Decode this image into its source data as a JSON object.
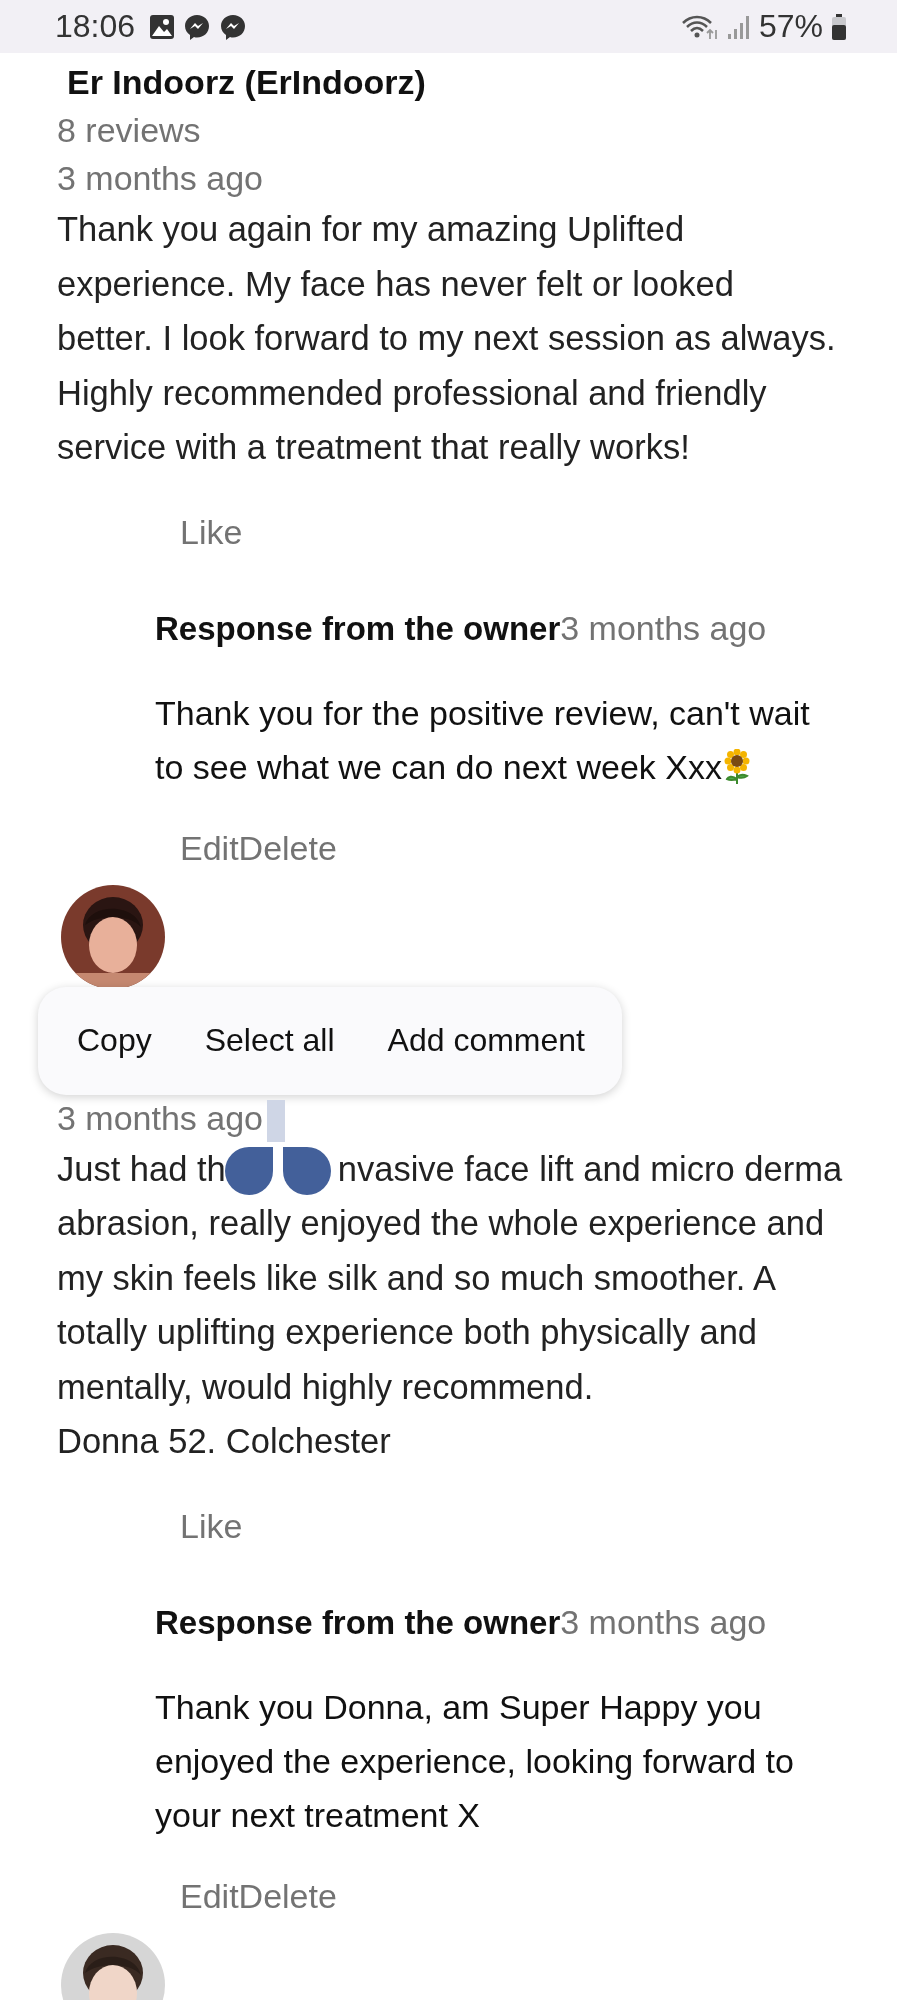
{
  "status_bar": {
    "time": "18:06",
    "battery": "57%"
  },
  "reviews": [
    {
      "name": "Er Indoorz (ErIndoorz)",
      "review_count": "8 reviews",
      "time": "3 months ago",
      "text": [
        "Thank you again for my amazing Uplifted experience. My face has never felt or looked better. I look forward to my next session as always.",
        "Highly recommended professional and friendly service with a treatment that really works!"
      ],
      "like": "Like",
      "reply": {
        "label": "Response from the owner",
        "time": "3 months ago",
        "text": "Thank you for the positive review, can't wait to see what we can do next week Xxx",
        "end_icon": true
      },
      "actions": [
        "Edit",
        "Delete"
      ]
    },
    {
      "avatar": {
        "kind": "picture"
      },
      "time": "3 months ago",
      "text": [
        {
          "kind": "covered_line",
          "before": "Just had th",
          "after": "nvasive face lift and micro derma"
        },
        "abrasion, really enjoyed the whole experience and my skin feels like silk and so much smoother. A totally uplifting experience both physically and mentally, would highly recommend.",
        "Donna 52. Colchester"
      ],
      "like": "Like",
      "reply": {
        "label": "Response from the owner",
        "time": "3 months ago",
        "text": "Thank you Donna, am Super Happy you enjoyed the experience, looking forward to your next treatment X",
        "end_icon": false
      },
      "actions": [
        "Edit",
        "Delete"
      ],
      "selection_menu": {
        "items": [
          "Copy",
          "Select all",
          "Add comment"
        ]
      }
    },
    {
      "avatar": {
        "kind": "picture"
      }
    }
  ]
}
